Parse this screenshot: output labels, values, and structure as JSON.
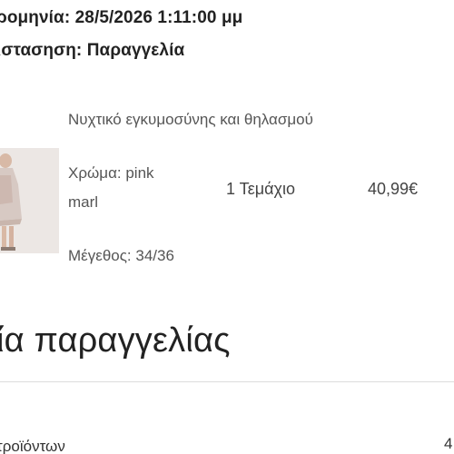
{
  "order": {
    "date_line": "ρομηνία: 28/5/2026 1:11:00 μμ",
    "status_line": "ιστασηση: Παραγγελία"
  },
  "item": {
    "name": "Νυχτικό εγκυμοσύνης και θηλασμού",
    "color_line1": "Χρώμα: pink",
    "color_line2": "marl",
    "size": "Μέγεθος: 34/36",
    "quantity": "1 Τεμάχιο",
    "price": "40,99€",
    "image": "product-thumbnail"
  },
  "summary": {
    "title": "ία παραγγελίας",
    "row_label": "τροϊόντων",
    "row_value": "4"
  },
  "colors": {
    "text": "#2b2b2b",
    "muted": "#555555",
    "divider": "#dcdcdc",
    "thumb_bg": "#e9e4e1"
  }
}
